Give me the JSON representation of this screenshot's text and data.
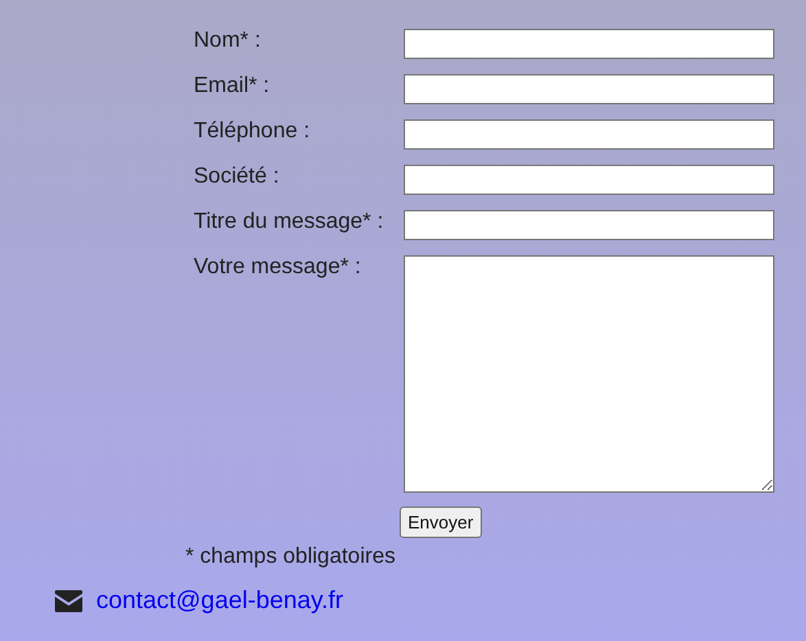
{
  "form": {
    "fields": [
      {
        "label": "Nom* :",
        "kind": "input"
      },
      {
        "label": "Email* :",
        "kind": "input"
      },
      {
        "label": "Téléphone :",
        "kind": "input"
      },
      {
        "label": "Société :",
        "kind": "input"
      },
      {
        "label": "Titre du message* :",
        "kind": "input"
      },
      {
        "label": "Votre message* :",
        "kind": "textarea"
      }
    ],
    "submit": "Envoyer",
    "note": "* champs obligatoires"
  },
  "contact": {
    "email": "contact@gael-benay.fr"
  }
}
